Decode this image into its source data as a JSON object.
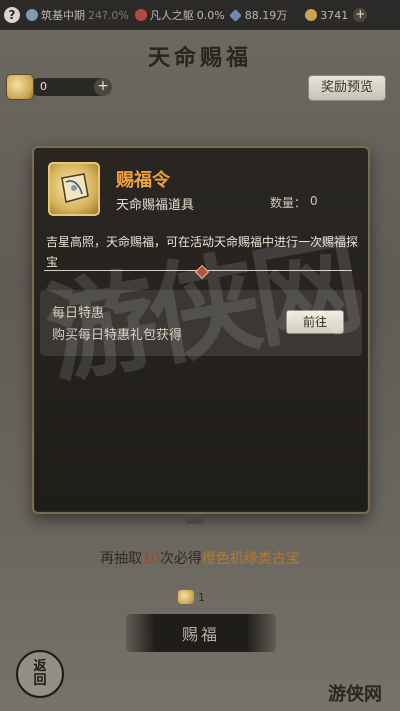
{
  "status_bar": {
    "help_glyph": "?",
    "realm": "筑基中期",
    "realm_progress": "24?.0%",
    "bottleneck": "凡人之躯",
    "bottleneck_progress": "0.0%",
    "spirit_stones": "88.19万",
    "currency": "3741",
    "currency_plus": "+"
  },
  "header": {
    "title": "天命赐福",
    "token_count": "0",
    "token_plus": "+",
    "reward_preview_label": "奖励预览"
  },
  "dialog": {
    "item_name": "赐福令",
    "item_type": "天命赐福道具",
    "quantity_label": "数量：",
    "quantity_value": "0",
    "description": "吉星高照，天命赐福，可在活动天命赐福中进行一次赐福探宝",
    "offer": {
      "title": "每日特惠",
      "description": "购买每日特惠礼包获得",
      "go_label": "前往"
    }
  },
  "footer": {
    "hint_prefix": "再抽取",
    "hint_count": "10",
    "hint_mid": "次必得",
    "hint_reward": "橙色机缘类古宝",
    "cost_value": "1",
    "draw_label": "赐福",
    "back_top": "返",
    "back_bottom": "回"
  },
  "watermark": {
    "text": "游侠网",
    "corner_text": "游侠网"
  },
  "colors": {
    "item_name": "#f0a040",
    "hint_number": "#9b4b2a",
    "hint_reward": "#b57a2a"
  },
  "icons": [
    "help-icon",
    "realm-icon",
    "spirit-stone-icon",
    "currency-icon",
    "token-bag-icon",
    "plus-icon",
    "item-token-icon"
  ]
}
